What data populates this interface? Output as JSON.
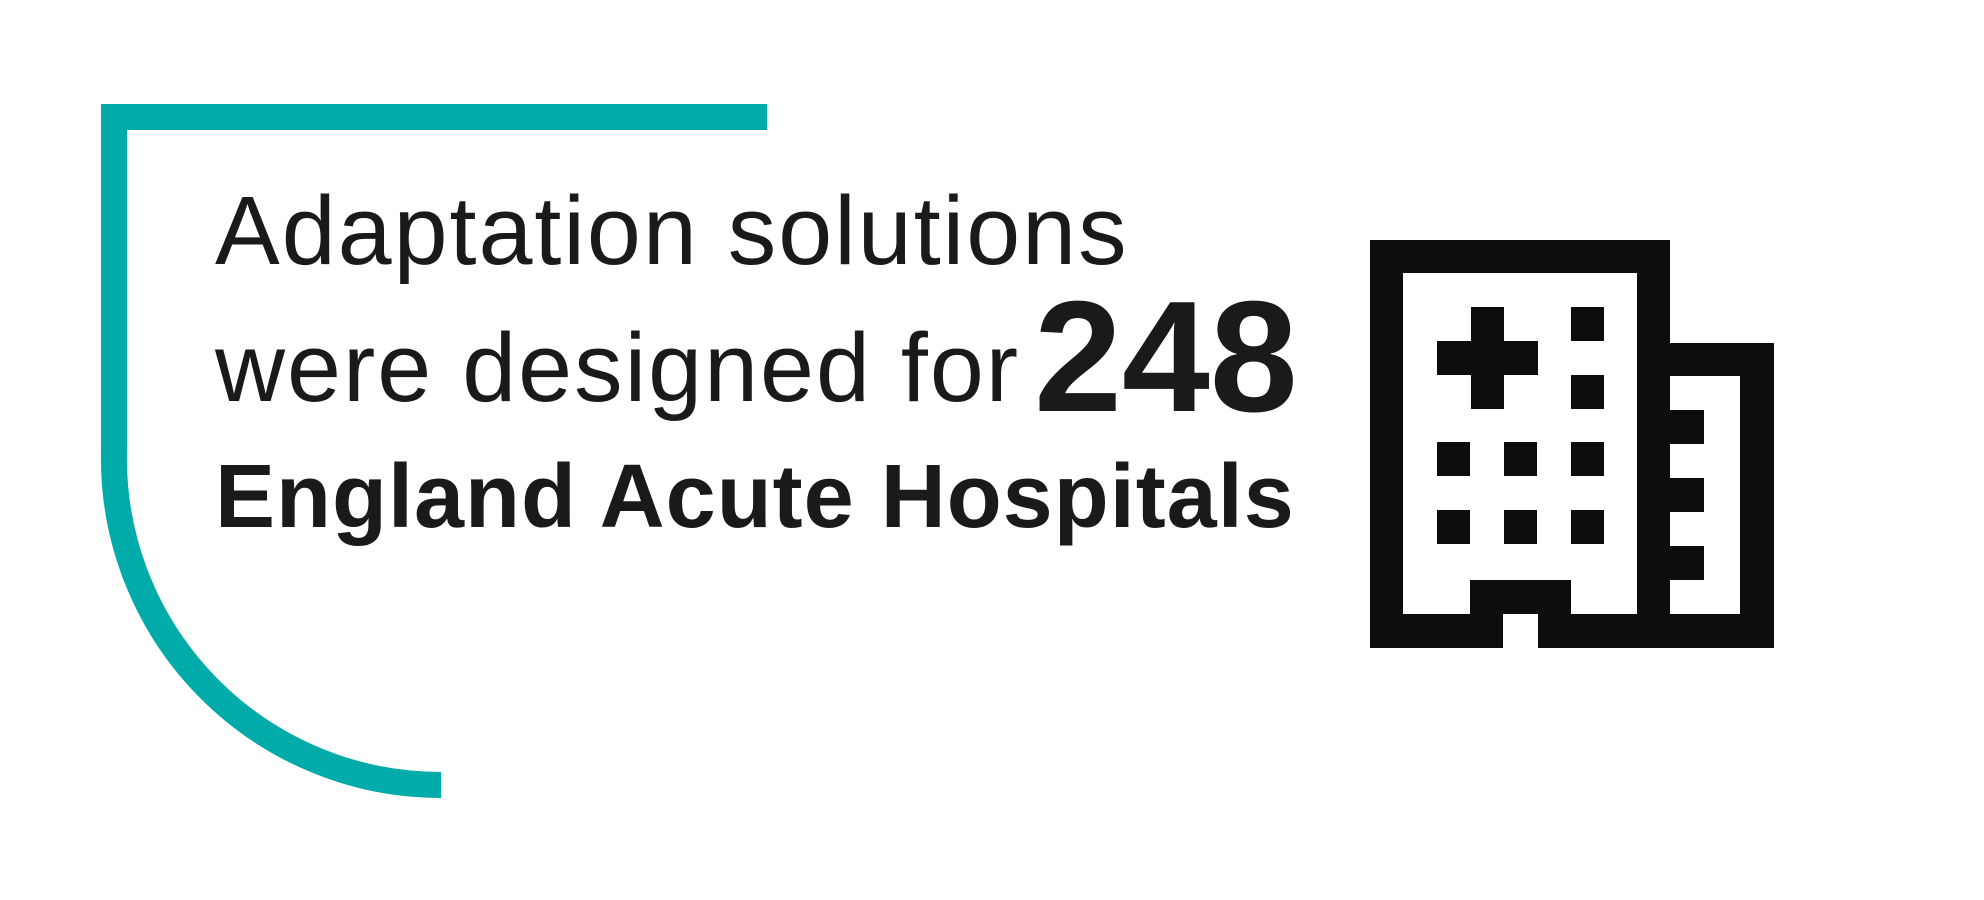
{
  "text": {
    "line1": "Adaptation solutions",
    "line2": "were designed for",
    "number": "248",
    "line3": "England Acute Hospitals"
  },
  "icon": "hospital-building-icon",
  "colors": {
    "accent": "#00ABA9",
    "text": "#1a1a1a",
    "icon": "#0d0d0d",
    "background": "#ffffff"
  }
}
